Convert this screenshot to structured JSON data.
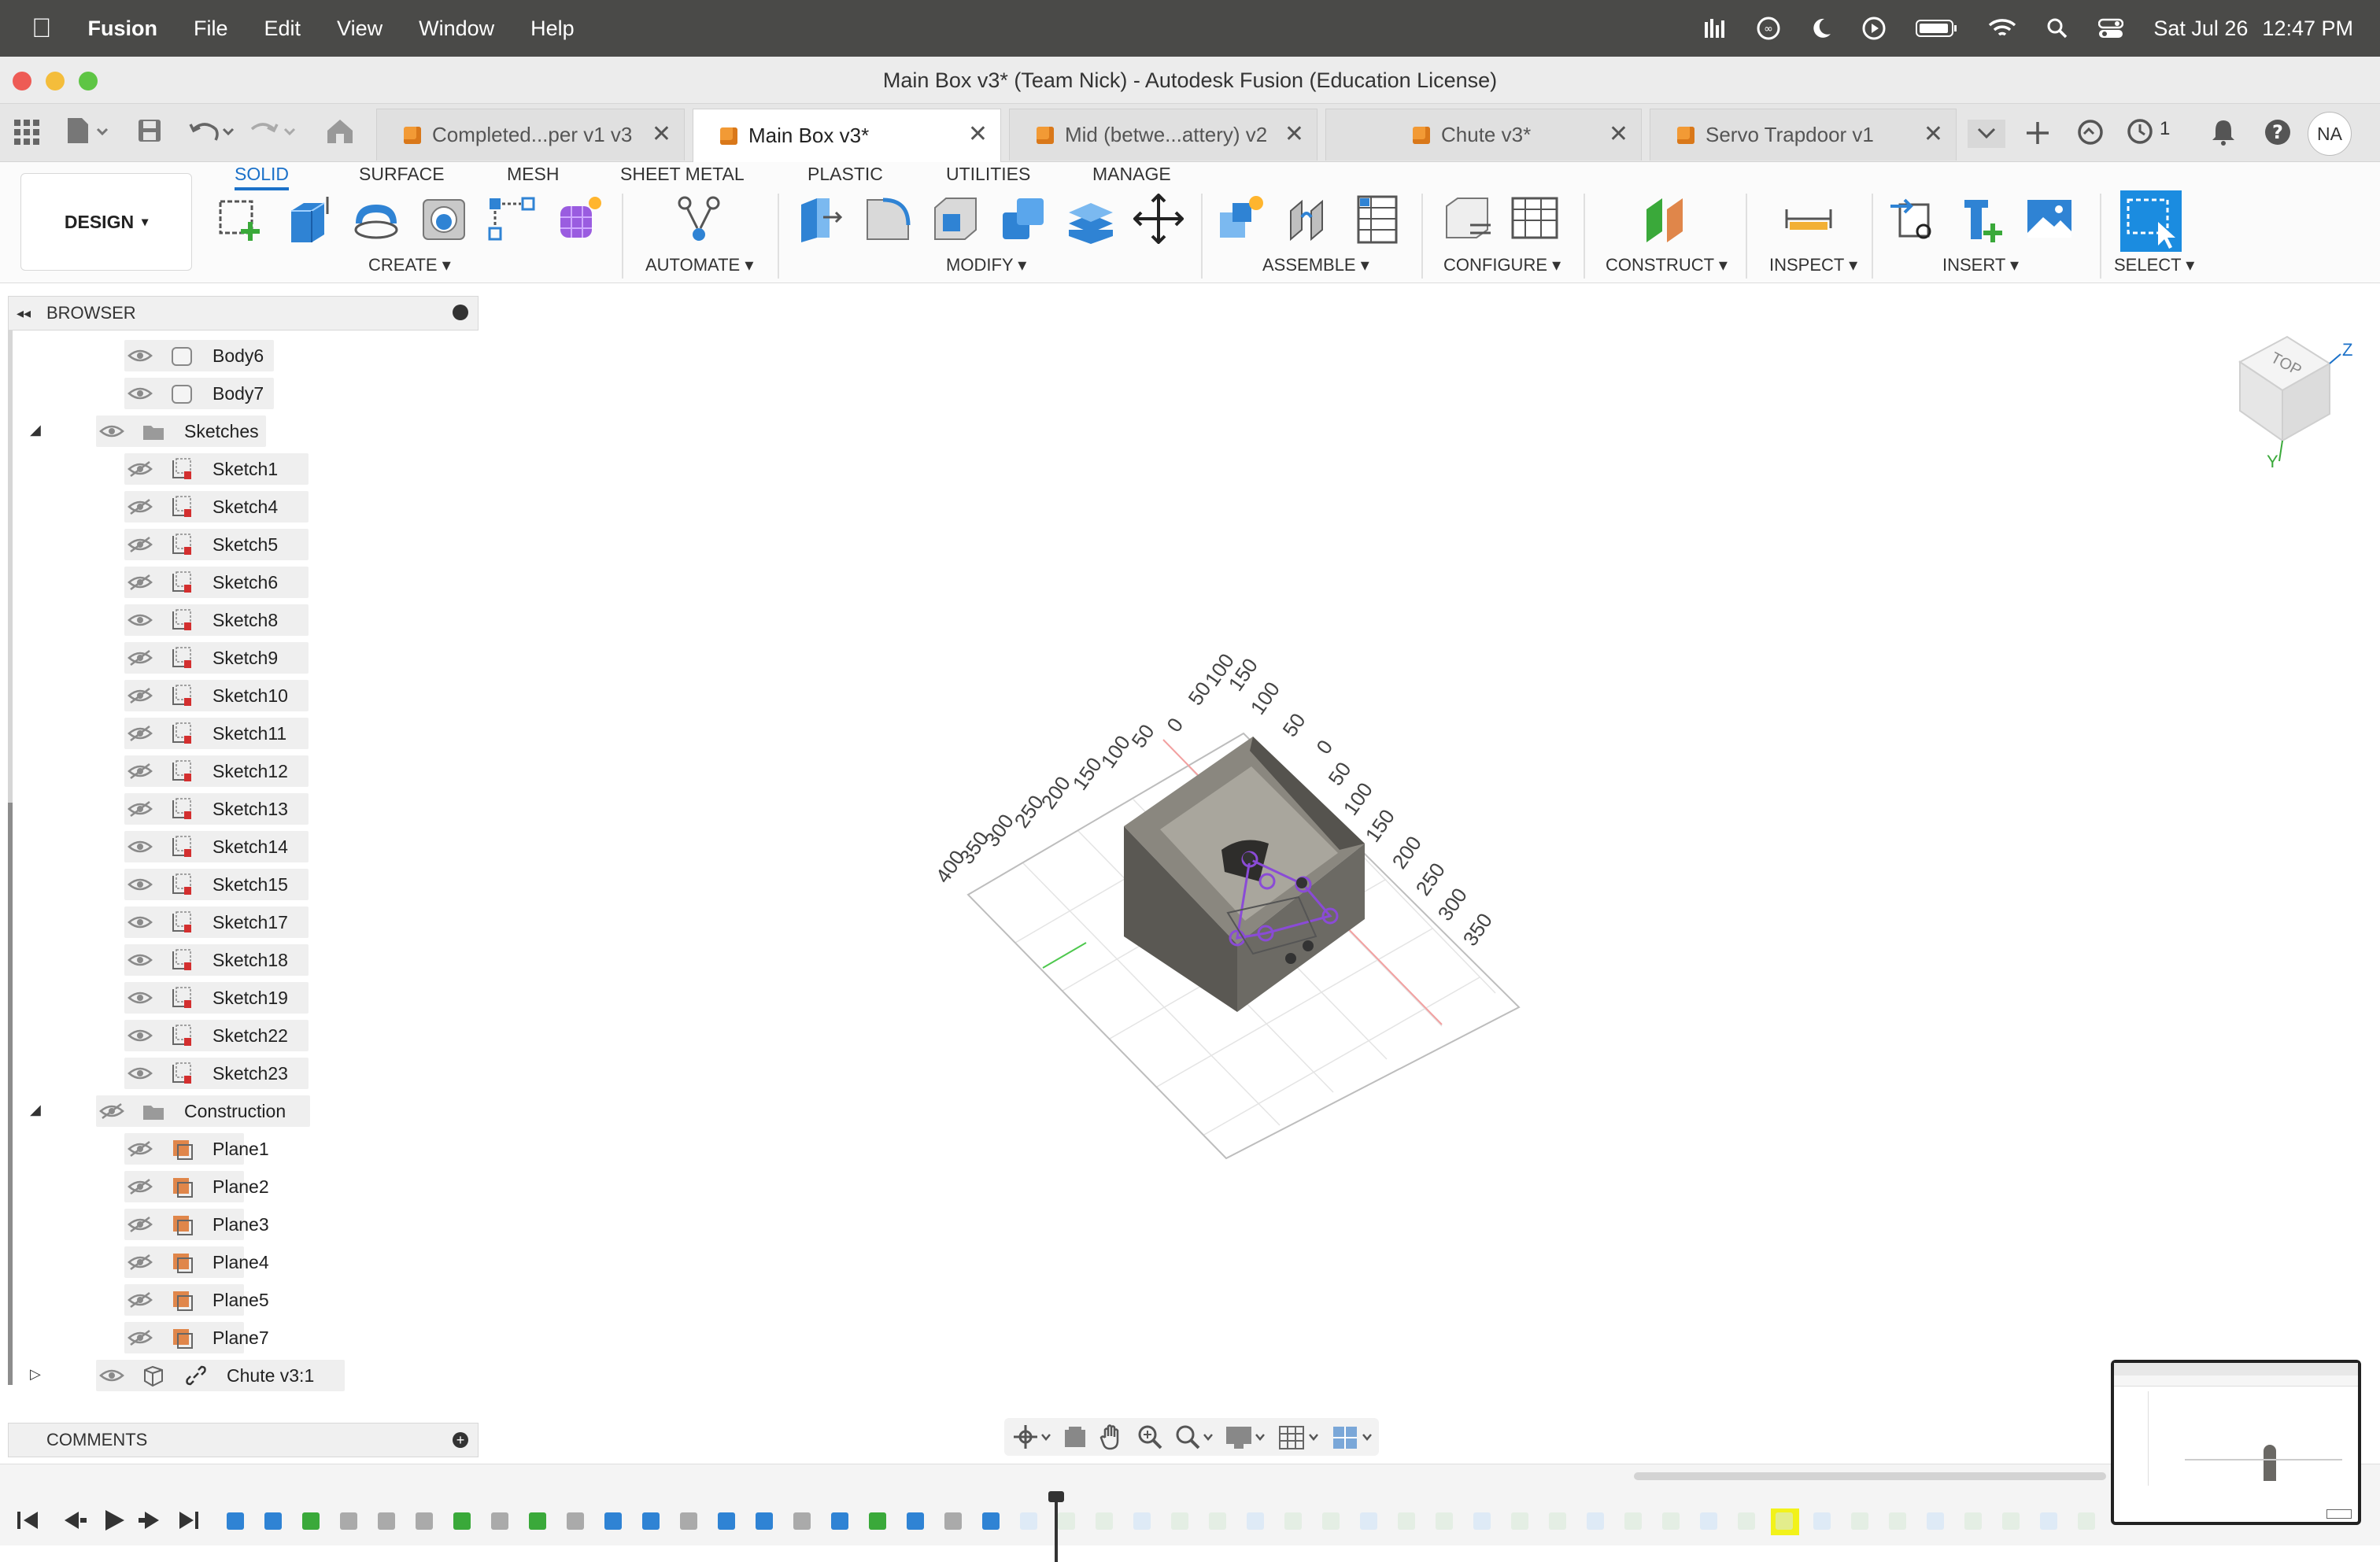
{
  "menubar": {
    "app": "Fusion",
    "items": [
      "File",
      "Edit",
      "View",
      "Window",
      "Help"
    ],
    "date": "Sat Jul 26",
    "time": "12:47 PM"
  },
  "window": {
    "title": "Main Box v3* (Team Nick) - Autodesk Fusion (Education License)"
  },
  "tabs": [
    {
      "label": "Completed...per v1 v3"
    },
    {
      "label": "Main Box v3*"
    },
    {
      "label": "Mid (betwe...attery) v2"
    },
    {
      "label": "Chute v3*"
    },
    {
      "label": "Servo Trapdoor v1"
    }
  ],
  "tabbar_right": {
    "jobs_count": "1",
    "user_initials": "NA"
  },
  "ribbon": {
    "workspace": "DESIGN",
    "tabs": [
      "SOLID",
      "SURFACE",
      "MESH",
      "SHEET METAL",
      "PLASTIC",
      "UTILITIES",
      "MANAGE"
    ],
    "groups": [
      "CREATE",
      "AUTOMATE",
      "MODIFY",
      "ASSEMBLE",
      "CONFIGURE",
      "CONSTRUCT",
      "INSPECT",
      "INSERT",
      "SELECT"
    ]
  },
  "browser": {
    "title": "BROWSER",
    "bodies": [
      "Body6",
      "Body7"
    ],
    "sketches_folder": "Sketches",
    "sketches": [
      {
        "name": "Sketch1",
        "visible": false
      },
      {
        "name": "Sketch4",
        "visible": false
      },
      {
        "name": "Sketch5",
        "visible": false
      },
      {
        "name": "Sketch6",
        "visible": false
      },
      {
        "name": "Sketch8",
        "visible": true
      },
      {
        "name": "Sketch9",
        "visible": false
      },
      {
        "name": "Sketch10",
        "visible": false
      },
      {
        "name": "Sketch11",
        "visible": false
      },
      {
        "name": "Sketch12",
        "visible": false
      },
      {
        "name": "Sketch13",
        "visible": false
      },
      {
        "name": "Sketch14",
        "visible": true
      },
      {
        "name": "Sketch15",
        "visible": true
      },
      {
        "name": "Sketch17",
        "visible": true
      },
      {
        "name": "Sketch18",
        "visible": true
      },
      {
        "name": "Sketch19",
        "visible": true
      },
      {
        "name": "Sketch22",
        "visible": true
      },
      {
        "name": "Sketch23",
        "visible": true
      }
    ],
    "construction_folder": "Construction",
    "planes": [
      "Plane1",
      "Plane2",
      "Plane3",
      "Plane4",
      "Plane5",
      "Plane7"
    ],
    "component": "Chute v3:1"
  },
  "comments": {
    "title": "COMMENTS"
  },
  "viewcube": {
    "face": "TOP",
    "axis_z": "Z",
    "axis_y": "Y"
  },
  "grid_labels": {
    "left_axis": [
      "400",
      "350",
      "300",
      "250",
      "200",
      "150",
      "100",
      "50",
      "0",
      "50",
      "100"
    ],
    "right_axis": [
      "150",
      "100",
      "50",
      "0",
      "50",
      "100",
      "150",
      "200",
      "250",
      "300",
      "350"
    ]
  },
  "colors": {
    "accent": "#1b71c9",
    "menubar": "#4a4a48",
    "tab_icon": "#f29a35",
    "sketch_icon": "#d32f2f",
    "plane_icon": "#e0864a"
  }
}
